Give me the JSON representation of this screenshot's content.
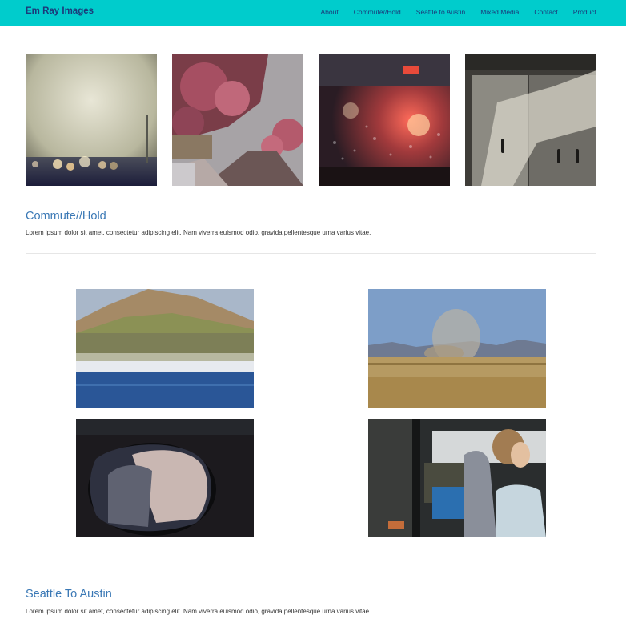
{
  "navbar": {
    "brand": "Em Ray Images",
    "links": [
      "About",
      "Commute//Hold",
      "Seattle to Austin",
      "Mixed Media",
      "Contact",
      "Product"
    ],
    "color": "#00cccc"
  },
  "gallery_top": [
    {
      "icon": "photo-blurry-traffic-lights"
    },
    {
      "icon": "photo-blossom-tree-street"
    },
    {
      "icon": "photo-rainy-windshield"
    },
    {
      "icon": "photo-metal-door-shadows"
    }
  ],
  "sections": [
    {
      "title": "Commute//Hold",
      "text": "Lorem ipsum dolor sit amet, consectetur adipiscing elit. Nam viverra euismod odio, gravida pellentesque urna varius vitae."
    },
    {
      "title": "Seattle To Austin",
      "text": "Lorem ipsum dolor sit amet, consectetur adipiscing elit. Nam viverra euismod odio, gravida pellentesque urna varius vitae."
    }
  ],
  "gallery_grid": [
    {
      "icon": "photo-blurred-hillside"
    },
    {
      "icon": "photo-dusty-field-mountains"
    },
    {
      "icon": "photo-side-mirror"
    },
    {
      "icon": "photo-car-passenger"
    }
  ]
}
